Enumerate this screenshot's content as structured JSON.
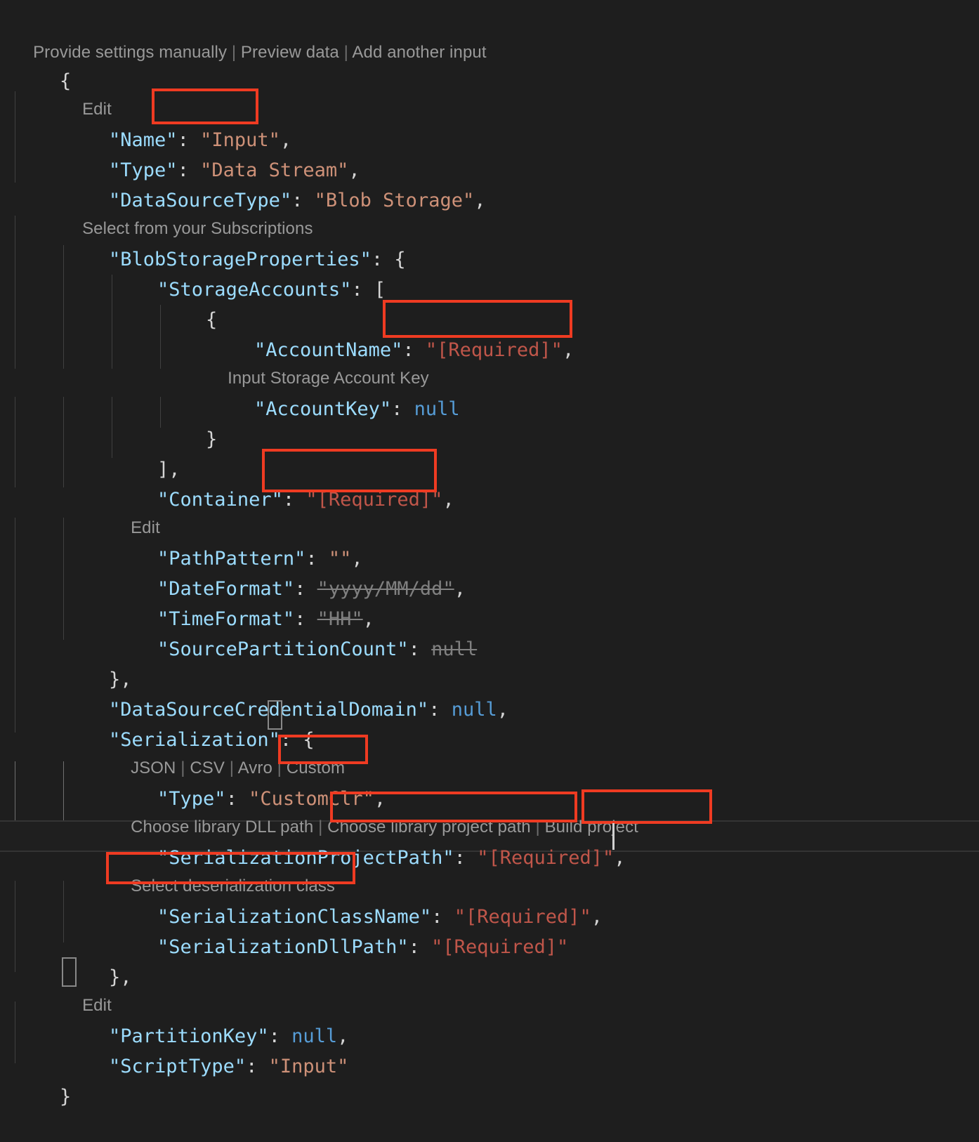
{
  "editor": {
    "language": "json",
    "theme": "dark",
    "background_color": "#1e1e1e",
    "colors": {
      "key": "#9cdcfe",
      "string": "#ce9178",
      "keyword_null": "#569cd6",
      "required_value": "#c0564a",
      "punctuation": "#d4d4d4",
      "codelens": "#999999",
      "strikethrough": "#808080",
      "annotation_box": "#ef3b22",
      "indent_guide": "#404040",
      "bracket_match": "#888888"
    }
  },
  "header_lens": {
    "items": [
      "Provide settings manually",
      "Preview data",
      "Add another input"
    ],
    "separator": "|"
  },
  "codelens": {
    "edit_name": "Edit",
    "select_subscriptions": "Select from your Subscriptions",
    "input_storage_account_key": "Input Storage Account Key",
    "edit_path": "Edit",
    "serialization_formats": [
      "JSON",
      "CSV",
      "Avro",
      "Custom"
    ],
    "library_actions": [
      "Choose library DLL path",
      "Choose library project path",
      "Build project"
    ],
    "select_deserialization_class": "Select deserialization class",
    "edit_partition": "Edit",
    "separator": "|"
  },
  "lines": {
    "open_brace": "{",
    "name": {
      "key": "\"Name\"",
      "colon": ": ",
      "value": "\"Input\"",
      "comma": ","
    },
    "type": {
      "key": "\"Type\"",
      "colon": ": ",
      "value": "\"Data Stream\"",
      "comma": ","
    },
    "data_source_type": {
      "key": "\"DataSourceType\"",
      "colon": ": ",
      "value": "\"Blob Storage\"",
      "comma": ","
    },
    "blob_storage_properties": {
      "key": "\"BlobStorageProperties\"",
      "colon": ": ",
      "value": "{"
    },
    "storage_accounts": {
      "key": "\"StorageAccounts\"",
      "colon": ": ",
      "value": "["
    },
    "account_open_brace": "{",
    "account_name": {
      "key": "\"AccountName\"",
      "colon": ": ",
      "value": "\"[Required]\"",
      "comma": ","
    },
    "account_key": {
      "key": "\"AccountKey\"",
      "colon": ": ",
      "value": "null"
    },
    "account_close_brace": "}",
    "storage_accounts_close": "],",
    "container": {
      "key": "\"Container\"",
      "colon": ": ",
      "value": "\"[Required]\"",
      "comma": ","
    },
    "path_pattern": {
      "key": "\"PathPattern\"",
      "colon": ": ",
      "value": "\"\"",
      "comma": ","
    },
    "date_format": {
      "key": "\"DateFormat\"",
      "colon": ": ",
      "value": "\"yyyy/MM/dd\"",
      "comma": ",",
      "struck": true
    },
    "time_format": {
      "key": "\"TimeFormat\"",
      "colon": ": ",
      "value": "\"HH\"",
      "comma": ",",
      "struck": true
    },
    "source_partition_count": {
      "key": "\"SourcePartitionCount\"",
      "colon": ": ",
      "value": "null",
      "struck": true
    },
    "blob_close": "},",
    "credential_domain": {
      "key": "\"DataSourceCredentialDomain\"",
      "colon": ": ",
      "value": "null",
      "comma": ","
    },
    "serialization": {
      "key": "\"Serialization\"",
      "colon": ": ",
      "value": "{"
    },
    "serialization_type": {
      "key": "\"Type\"",
      "colon": ": ",
      "value": "\"CustomClr\"",
      "comma": ","
    },
    "serialization_project_path": {
      "key": "\"SerializationProjectPath\"",
      "colon": ": ",
      "value": "\"[Required]\"",
      "comma": ","
    },
    "serialization_class_name": {
      "key": "\"SerializationClassName\"",
      "colon": ": ",
      "value": "\"[Required]\"",
      "comma": ","
    },
    "serialization_dll_path": {
      "key": "\"SerializationDllPath\"",
      "colon": ": ",
      "value": "\"[Required]\""
    },
    "serialization_close": "},",
    "partition_key": {
      "key": "\"PartitionKey\"",
      "colon": ": ",
      "value": "null",
      "comma": ","
    },
    "script_type": {
      "key": "\"ScriptType\"",
      "colon": ": ",
      "value": "\"Input\""
    },
    "close_brace": "}"
  },
  "annotations": [
    {
      "target": "name-value",
      "label": "\"Input\""
    },
    {
      "target": "account-name-value",
      "label": "\"[Required]\""
    },
    {
      "target": "container-value",
      "label": "\"[Required]\""
    },
    {
      "target": "serialization-format-custom",
      "label": "Custom"
    },
    {
      "target": "choose-library-project-path",
      "label": "Choose library project path"
    },
    {
      "target": "build-project",
      "label": "Build project"
    },
    {
      "target": "select-deserialization-class",
      "label": "Select deserialization class"
    }
  ]
}
